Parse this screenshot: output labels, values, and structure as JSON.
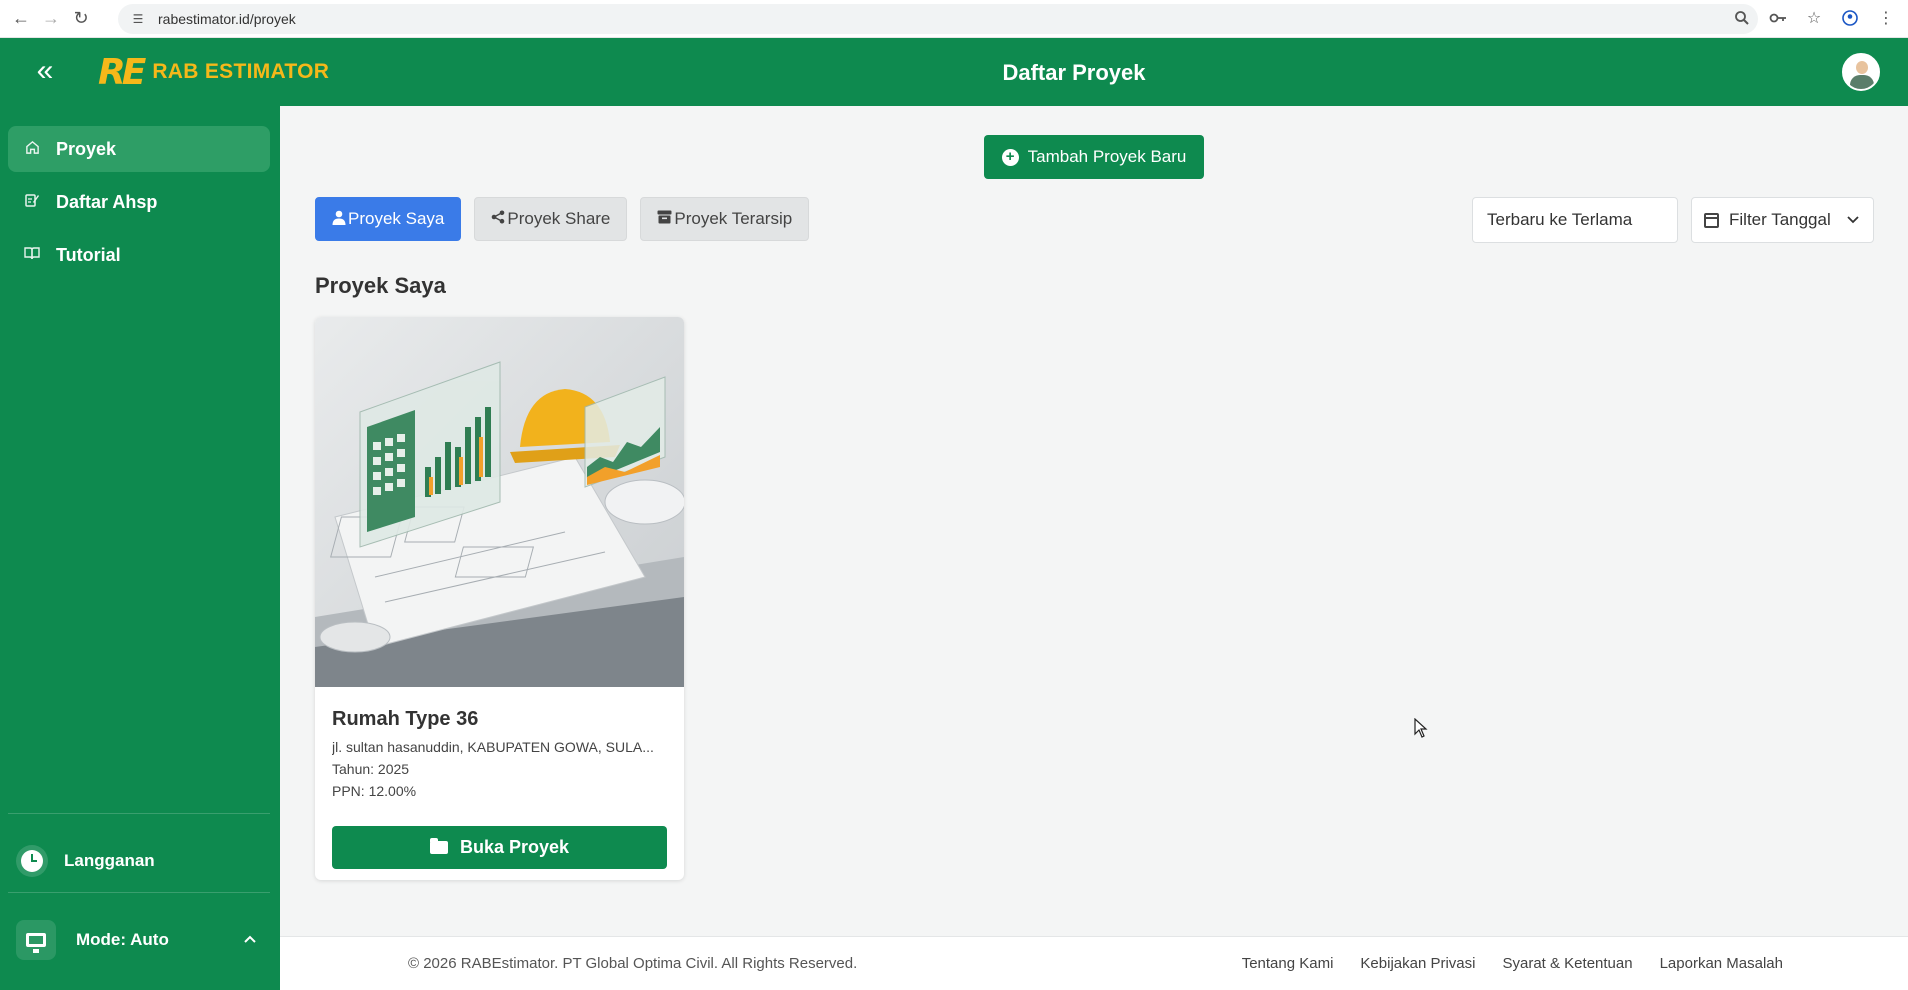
{
  "browser": {
    "url": "rabestimator.id/proyek"
  },
  "header": {
    "logo_mark": "RE",
    "logo_text": "RAB ESTIMATOR",
    "title": "Daftar Proyek"
  },
  "sidebar": {
    "items": [
      {
        "label": "Proyek",
        "icon": "home-icon",
        "active": true
      },
      {
        "label": "Daftar Ahsp",
        "icon": "edit-list-icon",
        "active": false
      },
      {
        "label": "Tutorial",
        "icon": "book-icon",
        "active": false
      }
    ],
    "subscription_label": "Langganan",
    "mode_label": "Mode: Auto"
  },
  "main": {
    "add_button_label": "Tambah Proyek Baru",
    "tabs": [
      {
        "label": "Proyek Saya",
        "icon": "user-icon",
        "active": true
      },
      {
        "label": "Proyek Share",
        "icon": "share-icon",
        "active": false
      },
      {
        "label": "Proyek Terarsip",
        "icon": "archive-icon",
        "active": false
      }
    ],
    "sort_value": "Terbaru ke Terlama",
    "filter_label": "Filter Tanggal",
    "section_title": "Proyek Saya",
    "projects": [
      {
        "title": "Rumah Type 36",
        "address": "jl. sultan hasanuddin, KABUPATEN GOWA, SULA...",
        "year": "Tahun: 2025",
        "ppn": "PPN: 12.00%",
        "open_label": "Buka Proyek"
      }
    ]
  },
  "footer": {
    "copyright": "© 2026 RABEstimator. PT Global Optima Civil. All Rights Reserved.",
    "links": [
      "Tentang Kami",
      "Kebijakan Privasi",
      "Syarat & Ketentuan",
      "Laporkan Masalah"
    ]
  },
  "colors": {
    "brand_green": "#0e8a4f",
    "logo_yellow": "#f5b81a",
    "tab_active_blue": "#3a7be8"
  }
}
